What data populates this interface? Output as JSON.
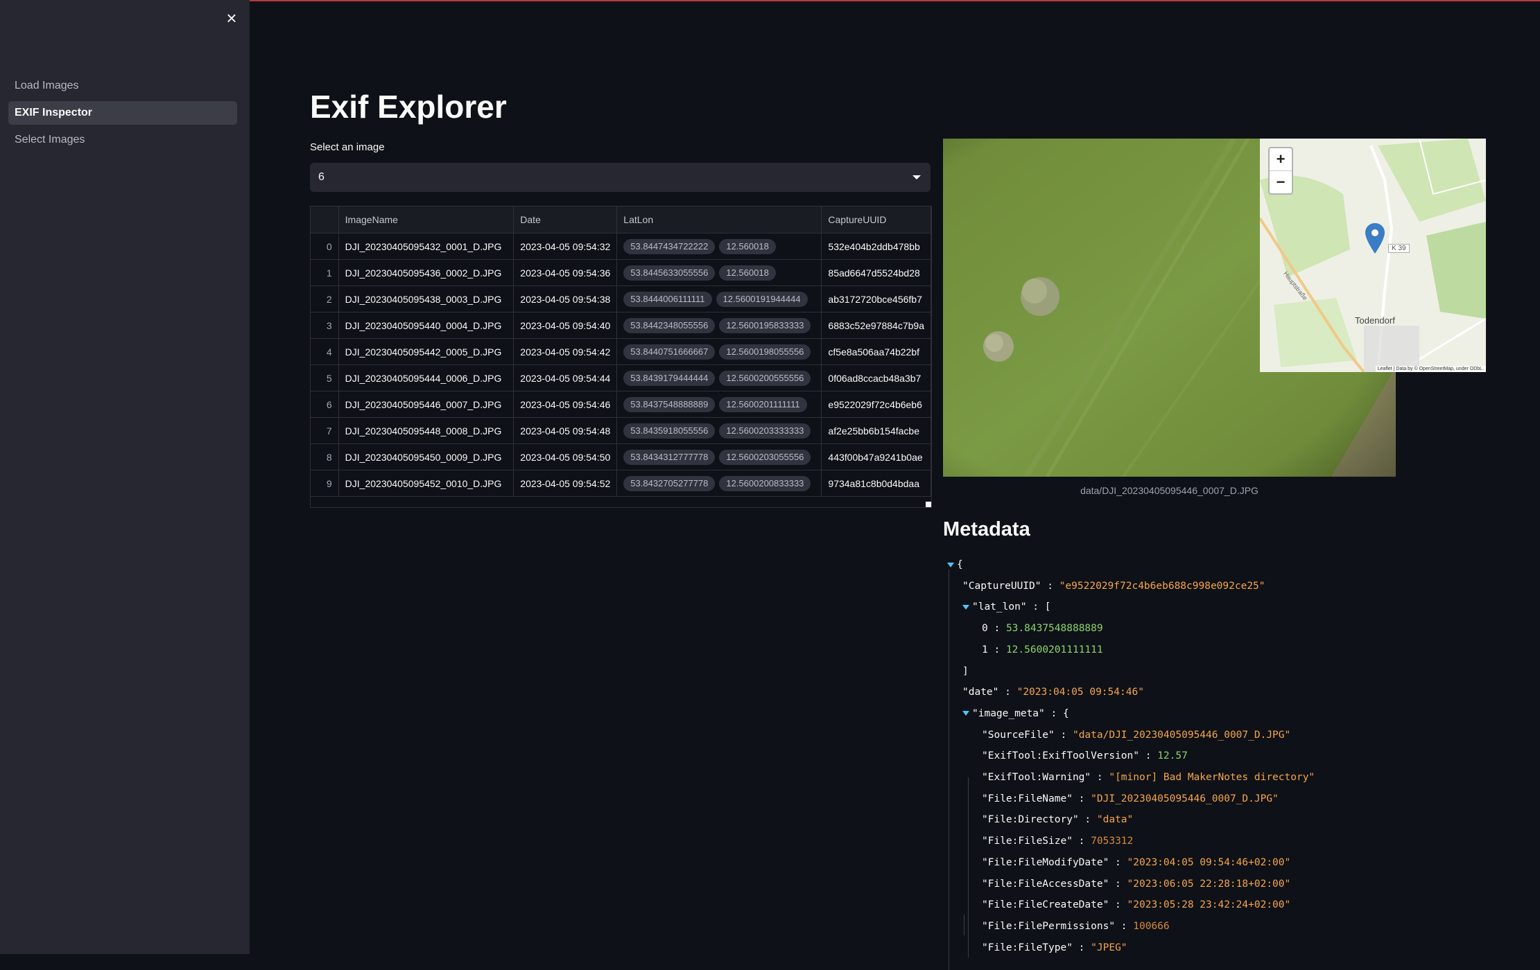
{
  "sidebar": {
    "close_icon": "×",
    "items": [
      {
        "label": "Load Images",
        "active": false
      },
      {
        "label": "EXIF Inspector",
        "active": true
      },
      {
        "label": "Select Images",
        "active": false
      }
    ]
  },
  "main": {
    "title": "Exif Explorer",
    "select_label": "Select an image",
    "select_value": "6"
  },
  "table": {
    "columns": [
      "",
      "ImageName",
      "Date",
      "LatLon",
      "CaptureUUID"
    ],
    "rows": [
      {
        "idx": "0",
        "name": "DJI_20230405095432_0001_D.JPG",
        "date": "2023-04-05 09:54:32",
        "lat": "53.8447434722222",
        "lon": "12.560018",
        "uuid": "532e404b2ddb478bb"
      },
      {
        "idx": "1",
        "name": "DJI_20230405095436_0002_D.JPG",
        "date": "2023-04-05 09:54:36",
        "lat": "53.8445633055556",
        "lon": "12.560018",
        "uuid": "85ad6647d5524bd28"
      },
      {
        "idx": "2",
        "name": "DJI_20230405095438_0003_D.JPG",
        "date": "2023-04-05 09:54:38",
        "lat": "53.8444006111111",
        "lon": "12.5600191944444",
        "uuid": "ab3172720bce456fb7"
      },
      {
        "idx": "3",
        "name": "DJI_20230405095440_0004_D.JPG",
        "date": "2023-04-05 09:54:40",
        "lat": "53.8442348055556",
        "lon": "12.5600195833333",
        "uuid": "6883c52e97884c7b9a"
      },
      {
        "idx": "4",
        "name": "DJI_20230405095442_0005_D.JPG",
        "date": "2023-04-05 09:54:42",
        "lat": "53.8440751666667",
        "lon": "12.5600198055556",
        "uuid": "cf5e8a506aa74b22bf"
      },
      {
        "idx": "5",
        "name": "DJI_20230405095444_0006_D.JPG",
        "date": "2023-04-05 09:54:44",
        "lat": "53.8439179444444",
        "lon": "12.5600200555556",
        "uuid": "0f06ad8ccacb48a3b7"
      },
      {
        "idx": "6",
        "name": "DJI_20230405095446_0007_D.JPG",
        "date": "2023-04-05 09:54:46",
        "lat": "53.8437548888889",
        "lon": "12.5600201111111",
        "uuid": "e9522029f72c4b6eb6"
      },
      {
        "idx": "7",
        "name": "DJI_20230405095448_0008_D.JPG",
        "date": "2023-04-05 09:54:48",
        "lat": "53.8435918055556",
        "lon": "12.5600203333333",
        "uuid": "af2e25bb6b154facbe"
      },
      {
        "idx": "8",
        "name": "DJI_20230405095450_0009_D.JPG",
        "date": "2023-04-05 09:54:50",
        "lat": "53.8434312777778",
        "lon": "12.5600203055556",
        "uuid": "443f00b47a9241b0ae"
      },
      {
        "idx": "9",
        "name": "DJI_20230405095452_0010_D.JPG",
        "date": "2023-04-05 09:54:52",
        "lat": "53.8432705277778",
        "lon": "12.5600200833333",
        "uuid": "9734a81c8b0d4bdaa"
      }
    ]
  },
  "image": {
    "caption": "data/DJI_20230405095446_0007_D.JPG"
  },
  "map": {
    "zoom_in": "+",
    "zoom_out": "−",
    "town": "Todendorf",
    "road": "K 39",
    "street": "Hauptstraße",
    "attribution": "Leaflet | Data by © OpenStreetMap, under ODbL."
  },
  "metadata": {
    "title": "Metadata",
    "lines": [
      {
        "indent": 0,
        "toggle": true,
        "key": "",
        "value": "{",
        "type": "brace"
      },
      {
        "indent": 1,
        "toggle": false,
        "key": "\"CaptureUUID\"",
        "value": "\"e9522029f72c4b6eb688c998e092ce25\"",
        "type": "s"
      },
      {
        "indent": 1,
        "toggle": true,
        "key": "\"lat_lon\"",
        "value": "[",
        "type": "brace"
      },
      {
        "indent": 2,
        "toggle": false,
        "key": "0",
        "value": "53.8437548888889",
        "type": "n"
      },
      {
        "indent": 2,
        "toggle": false,
        "key": "1",
        "value": "12.5600201111111",
        "type": "n"
      },
      {
        "indent": 1,
        "toggle": false,
        "key": "",
        "value": "]",
        "type": "brace"
      },
      {
        "indent": 1,
        "toggle": false,
        "key": "\"date\"",
        "value": "\"2023:04:05 09:54:46\"",
        "type": "s"
      },
      {
        "indent": 1,
        "toggle": true,
        "key": "\"image_meta\"",
        "value": "{",
        "type": "brace"
      },
      {
        "indent": 2,
        "toggle": false,
        "key": "\"SourceFile\"",
        "value": "\"data/DJI_20230405095446_0007_D.JPG\"",
        "type": "s"
      },
      {
        "indent": 2,
        "toggle": false,
        "key": "\"ExifTool:ExifToolVersion\"",
        "value": "12.57",
        "type": "n"
      },
      {
        "indent": 2,
        "toggle": false,
        "key": "\"ExifTool:Warning\"",
        "value": "\"[minor] Bad MakerNotes directory\"",
        "type": "s"
      },
      {
        "indent": 2,
        "toggle": false,
        "key": "\"File:FileName\"",
        "value": "\"DJI_20230405095446_0007_D.JPG\"",
        "type": "s"
      },
      {
        "indent": 2,
        "toggle": false,
        "key": "\"File:Directory\"",
        "value": "\"data\"",
        "type": "s"
      },
      {
        "indent": 2,
        "toggle": false,
        "key": "\"File:FileSize\"",
        "value": "7053312",
        "type": "n2"
      },
      {
        "indent": 2,
        "toggle": false,
        "key": "\"File:FileModifyDate\"",
        "value": "\"2023:04:05 09:54:46+02:00\"",
        "type": "s"
      },
      {
        "indent": 2,
        "toggle": false,
        "key": "\"File:FileAccessDate\"",
        "value": "\"2023:06:05 22:28:18+02:00\"",
        "type": "s"
      },
      {
        "indent": 2,
        "toggle": false,
        "key": "\"File:FileCreateDate\"",
        "value": "\"2023:05:28 23:42:24+02:00\"",
        "type": "s"
      },
      {
        "indent": 2,
        "toggle": false,
        "key": "\"File:FilePermissions\"",
        "value": "100666",
        "type": "n2"
      },
      {
        "indent": 2,
        "toggle": false,
        "key": "\"File:FileType\"",
        "value": "\"JPEG\"",
        "type": "s"
      }
    ]
  },
  "colors": {
    "background": "#0e1117",
    "sidebar": "#262730",
    "json_string": "#f6a54b",
    "json_number": "#8bd46f",
    "toggle": "#4fc3f7"
  },
  "icons": [
    "close-icon",
    "chevron-down-icon",
    "map-marker-icon",
    "zoom-in-icon",
    "zoom-out-icon",
    "json-toggle-icon"
  ]
}
